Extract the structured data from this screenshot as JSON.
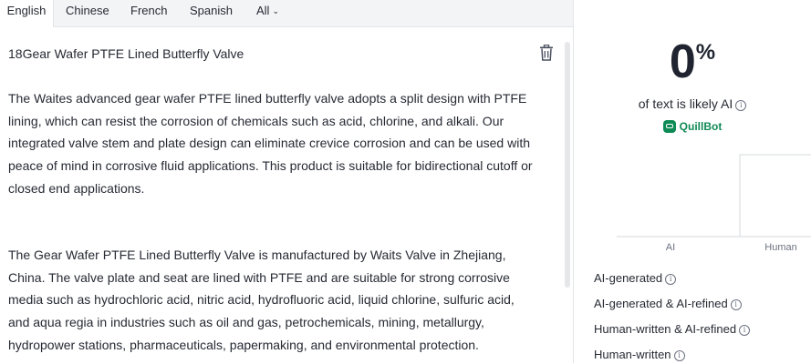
{
  "tabs": [
    {
      "label": "English",
      "active": true
    },
    {
      "label": "Chinese",
      "active": false
    },
    {
      "label": "French",
      "active": false
    },
    {
      "label": "Spanish",
      "active": false
    },
    {
      "label": "All",
      "active": false
    }
  ],
  "editor": {
    "title": "18Gear Wafer PTFE Lined Butterfly Valve",
    "paragraphs": [
      "The Waites advanced gear wafer PTFE lined butterfly valve adopts a split design with PTFE lining, which can resist the corrosion of chemicals such as acid, chlorine, and alkali. Our integrated valve stem and plate design can eliminate crevice corrosion and can be used with peace of mind in corrosive fluid applications. This product is suitable for bidirectional cutoff or closed end applications.",
      "The Gear Wafer PTFE Lined Butterfly Valve is manufactured by Waits Valve in Zhejiang, China. The valve plate and seat are lined with PTFE and are suitable for strong corrosive media such as hydrochloric acid, nitric acid, hydrofluoric acid, liquid chlorine, sulfuric acid, and aqua regia in industries such as oil and gas, petrochemicals, mining, metallurgy, hydropower stations, pharmaceuticals, papermaking, and environmental protection."
    ],
    "icons": {
      "delete": "trash-icon"
    }
  },
  "result": {
    "percent": "0",
    "percent_sign": "%",
    "subtitle": "of text is likely AI",
    "brand": "QuillBot"
  },
  "chart_data": {
    "type": "bar",
    "categories": [
      "AI",
      "Human"
    ],
    "values": [
      0,
      100
    ],
    "ylim": [
      0,
      100
    ],
    "grid": false
  },
  "legend": [
    {
      "label": "AI-generated",
      "color": "#f4a340",
      "filled": true
    },
    {
      "label": "AI-generated & AI-refined",
      "color": "#f9dcb8",
      "filled": true
    },
    {
      "label": "Human-written & AI-refined",
      "color": "#c9dcf4",
      "filled": true
    },
    {
      "label": "Human-written",
      "color": "#e3e5e9",
      "filled": false
    }
  ]
}
